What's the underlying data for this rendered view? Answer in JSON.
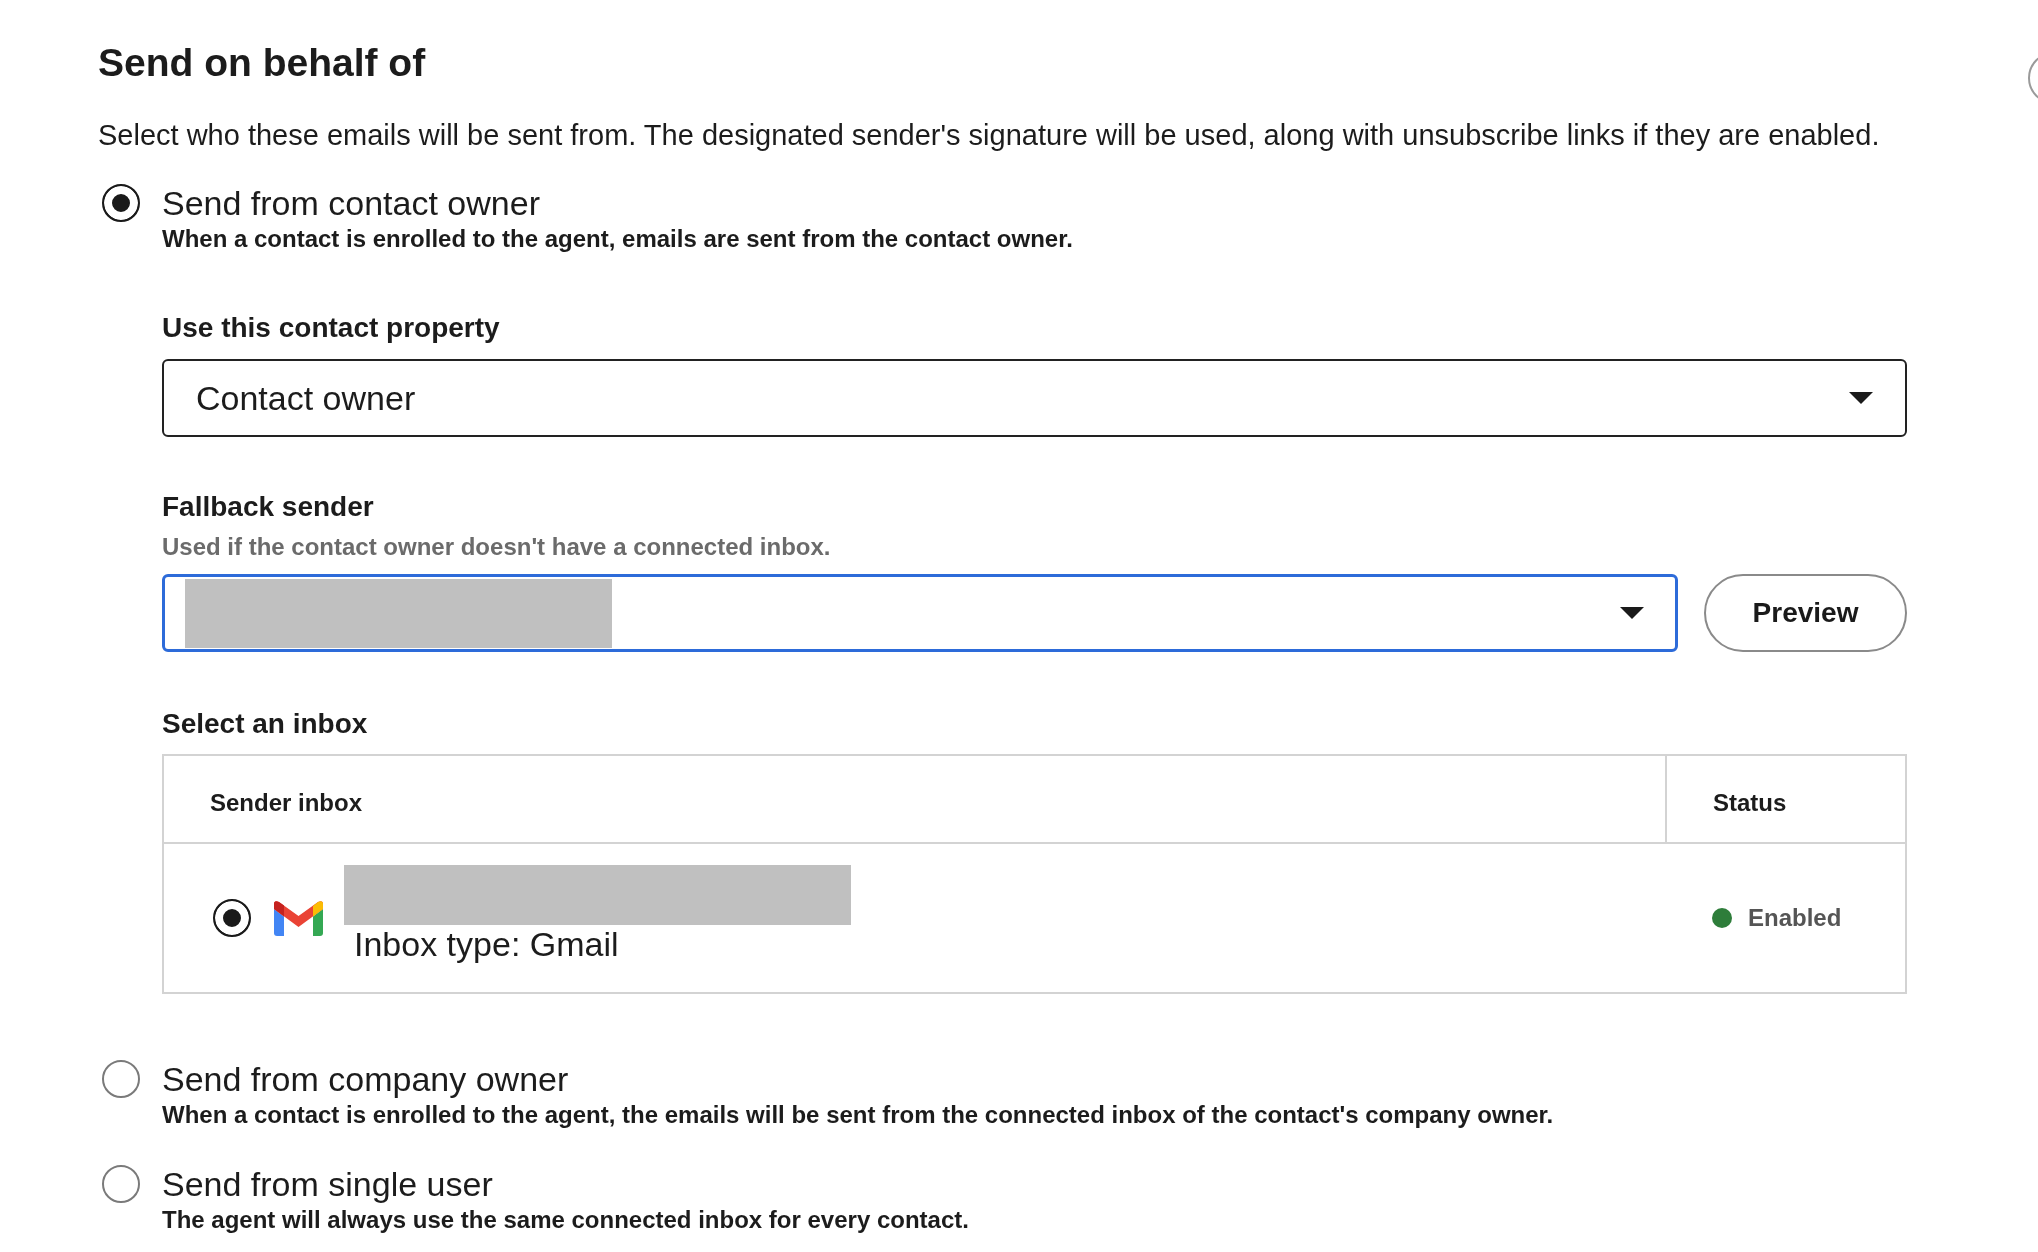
{
  "header": {
    "title": "Send on behalf of",
    "description": "Select who these emails will be sent from. The designated sender's signature will be used, along with unsubscribe links if they are enabled."
  },
  "sender_options": [
    {
      "label": "Send from contact owner",
      "description": "When a contact is enrolled to the agent, emails are sent from the contact owner.",
      "selected": true,
      "settings": {
        "property_field": {
          "label": "Use this contact property",
          "value": "Contact owner"
        },
        "fallback_field": {
          "label": "Fallback sender",
          "hint": "Used if the contact owner doesn't have a connected inbox.",
          "value_redacted": true,
          "focused": true
        },
        "preview_button": {
          "label": "Preview"
        },
        "inbox_table": {
          "label": "Select an inbox",
          "columns": [
            "Sender inbox",
            "Status"
          ],
          "rows": [
            {
              "selected": true,
              "address_redacted": true,
              "inbox_type": "Inbox type: Gmail",
              "status": "Enabled",
              "color": "#2e7d3a"
            }
          ]
        }
      }
    },
    {
      "label": "Send from company owner",
      "description": "When a contact is enrolled to the agent, the emails will be sent from the connected inbox of the contact's company owner.",
      "selected": false
    },
    {
      "label": "Send from single user",
      "description": "The agent will always use the same connected inbox for every contact.",
      "selected": false
    }
  ]
}
